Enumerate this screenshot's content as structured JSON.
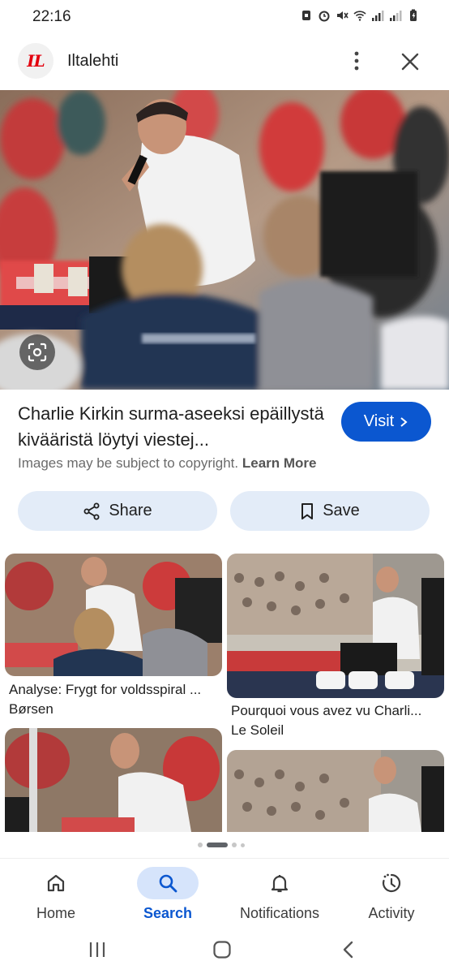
{
  "status": {
    "time": "22:16"
  },
  "header": {
    "logo_text": "IL",
    "site_name": "Iltalehti"
  },
  "result": {
    "title": "Charlie Kirkin surma-aseeksi epäillystä kivääristä löytyi viestej...",
    "visit_label": "Visit",
    "copyright_text": "Images may be subject to copyright.",
    "learn_more_label": "Learn More",
    "share_label": "Share",
    "save_label": "Save"
  },
  "related": [
    {
      "caption": "Analyse: Frygt for voldsspiral ...",
      "source": "Børsen"
    },
    {
      "caption": "Pourquoi vous avez vu Charli...",
      "source": "Le Soleil"
    }
  ],
  "pager": {
    "pages": 4,
    "active": 1
  },
  "bottom_nav": [
    {
      "label": "Home",
      "icon": "home-icon"
    },
    {
      "label": "Search",
      "icon": "search-icon"
    },
    {
      "label": "Notifications",
      "icon": "bell-icon"
    },
    {
      "label": "Activity",
      "icon": "activity-icon"
    }
  ],
  "colors": {
    "accent": "#0b57d0",
    "chip_bg": "#e3ecf8",
    "logo_red": "#e3000f"
  }
}
